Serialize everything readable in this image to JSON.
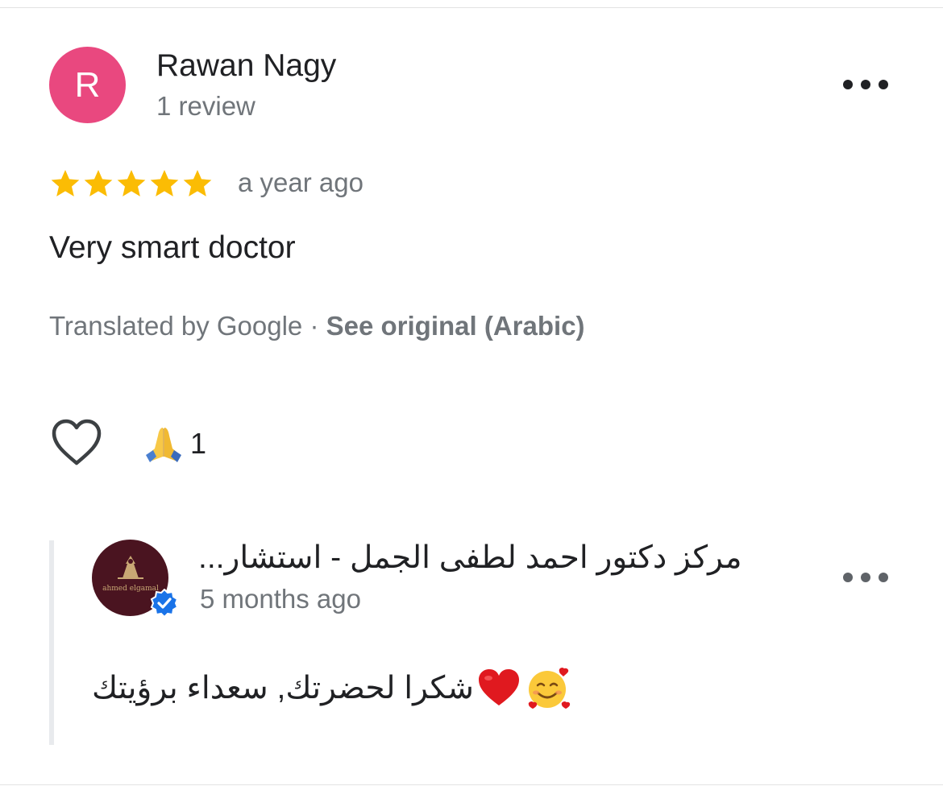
{
  "review": {
    "reviewer_name": "Rawan Nagy",
    "reviewer_initial": "R",
    "avatar_color": "#e9487f",
    "review_count": "1 review",
    "rating": 5,
    "rating_max": 5,
    "star_color": "#fbbc04",
    "time": "a year ago",
    "text": "Very smart doctor",
    "translated_by": "Translated by Google · ",
    "see_original": "See original (Arabic)",
    "like_icon": "heart-outline-icon",
    "reaction_icon": "folded-hands-emoji",
    "reaction_count": "1",
    "menu_icon": "more-horizontal-icon"
  },
  "owner_reply": {
    "owner_name": "مركز دكتور احمد لطفى الجمل - استشار...",
    "logo_text": "ahmed elgamal",
    "verified_icon": "verified-badge-icon",
    "time": "5 months ago",
    "text": "شكرا لحضرتك, سعداء برؤيتك",
    "heart_icon": "red-heart-emoji",
    "smile_icon": "smiling-face-with-hearts-emoji",
    "menu_icon": "more-horizontal-icon"
  }
}
